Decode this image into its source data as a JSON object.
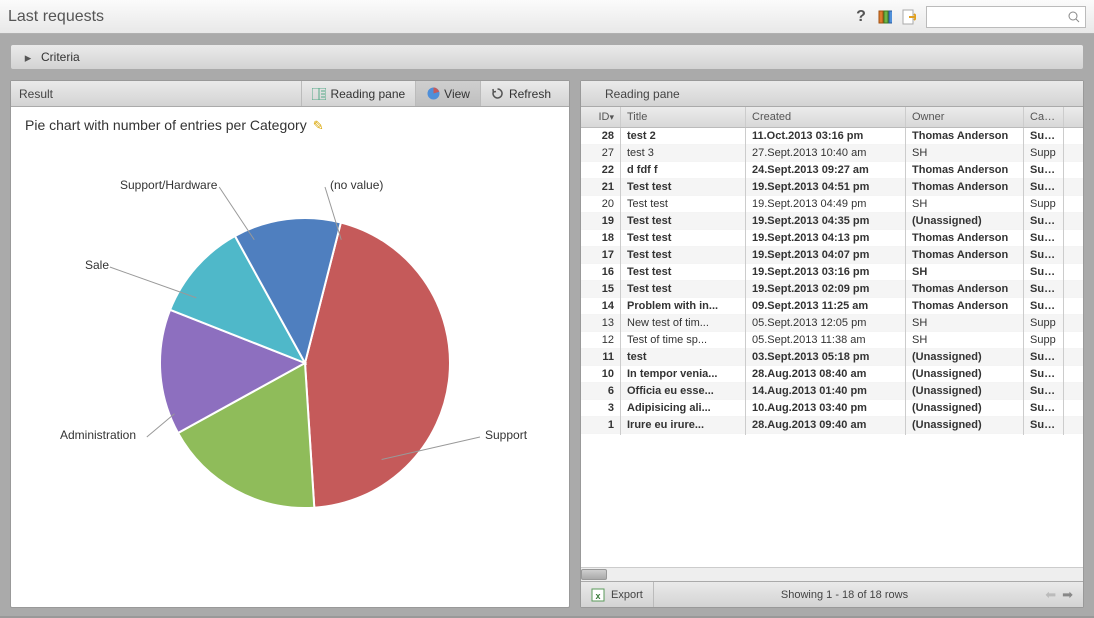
{
  "titlebar": {
    "title": "Last requests"
  },
  "criteria": {
    "label": "Criteria"
  },
  "left_pane": {
    "result_label": "Result",
    "reading_pane_btn": "Reading pane",
    "view_btn": "View",
    "refresh_btn": "Refresh"
  },
  "chart_data": {
    "type": "pie",
    "title": "Pie chart with number of entries per Category",
    "series": [
      {
        "name": "Support",
        "value": 45,
        "color": "#c55a5a"
      },
      {
        "name": "Administration",
        "value": 18,
        "color": "#8fbc5a"
      },
      {
        "name": "Sale",
        "value": 14,
        "color": "#8d6fbf"
      },
      {
        "name": "Support/Hardware",
        "value": 11,
        "color": "#4fb8c9"
      },
      {
        "name": "(no value)",
        "value": 12,
        "color": "#4f7fbf"
      }
    ]
  },
  "right_pane": {
    "header": "Reading pane",
    "columns": {
      "id": "ID",
      "title": "Title",
      "created": "Created",
      "owner": "Owner",
      "category": "Categ"
    },
    "rows": [
      {
        "id": 28,
        "title": "test 2",
        "created": "11.Oct.2013 03:16 pm",
        "owner": "Thomas Anderson",
        "category": "Supp",
        "bold": true
      },
      {
        "id": 27,
        "title": "test 3",
        "created": "27.Sept.2013 10:40 am",
        "owner": "SH",
        "category": "Supp",
        "bold": false
      },
      {
        "id": 22,
        "title": "d fdf f",
        "created": "24.Sept.2013 09:27 am",
        "owner": "Thomas Anderson",
        "category": "Supp",
        "bold": true
      },
      {
        "id": 21,
        "title": "Test test",
        "created": "19.Sept.2013 04:51 pm",
        "owner": "Thomas Anderson",
        "category": "Supp",
        "bold": true
      },
      {
        "id": 20,
        "title": "Test test",
        "created": "19.Sept.2013 04:49 pm",
        "owner": "SH",
        "category": "Supp",
        "bold": false
      },
      {
        "id": 19,
        "title": "Test test",
        "created": "19.Sept.2013 04:35 pm",
        "owner": "(Unassigned)",
        "category": "Supp",
        "bold": true
      },
      {
        "id": 18,
        "title": "Test test",
        "created": "19.Sept.2013 04:13 pm",
        "owner": "Thomas Anderson",
        "category": "Supp",
        "bold": true
      },
      {
        "id": 17,
        "title": "Test test",
        "created": "19.Sept.2013 04:07 pm",
        "owner": "Thomas Anderson",
        "category": "Supp",
        "bold": true
      },
      {
        "id": 16,
        "title": "Test test",
        "created": "19.Sept.2013 03:16 pm",
        "owner": "SH",
        "category": "Supp",
        "bold": true
      },
      {
        "id": 15,
        "title": "Test test",
        "created": "19.Sept.2013 02:09 pm",
        "owner": "Thomas Anderson",
        "category": "Supp",
        "bold": true
      },
      {
        "id": 14,
        "title": "Problem with in...",
        "created": "09.Sept.2013 11:25 am",
        "owner": "Thomas Anderson",
        "category": "Supp",
        "bold": true
      },
      {
        "id": 13,
        "title": "New test of tim...",
        "created": "05.Sept.2013 12:05 pm",
        "owner": "SH",
        "category": "Supp",
        "bold": false
      },
      {
        "id": 12,
        "title": "Test of time sp...",
        "created": "05.Sept.2013 11:38 am",
        "owner": "SH",
        "category": "Supp",
        "bold": false
      },
      {
        "id": 11,
        "title": "test",
        "created": "03.Sept.2013 05:18 pm",
        "owner": "(Unassigned)",
        "category": "Supp",
        "bold": true
      },
      {
        "id": 10,
        "title": "In tempor venia...",
        "created": "28.Aug.2013 08:40 am",
        "owner": "(Unassigned)",
        "category": "Supp",
        "bold": true
      },
      {
        "id": 6,
        "title": "Officia eu esse...",
        "created": "14.Aug.2013 01:40 pm",
        "owner": "(Unassigned)",
        "category": "Supp",
        "bold": true
      },
      {
        "id": 3,
        "title": "Adipisicing ali...",
        "created": "10.Aug.2013 03:40 pm",
        "owner": "(Unassigned)",
        "category": "Supp",
        "bold": true
      },
      {
        "id": 1,
        "title": "Irure eu irure...",
        "created": "28.Aug.2013 09:40 am",
        "owner": "(Unassigned)",
        "category": "Supp",
        "bold": true
      }
    ]
  },
  "footer": {
    "export": "Export",
    "status": "Showing 1 - 18 of 18 rows"
  }
}
